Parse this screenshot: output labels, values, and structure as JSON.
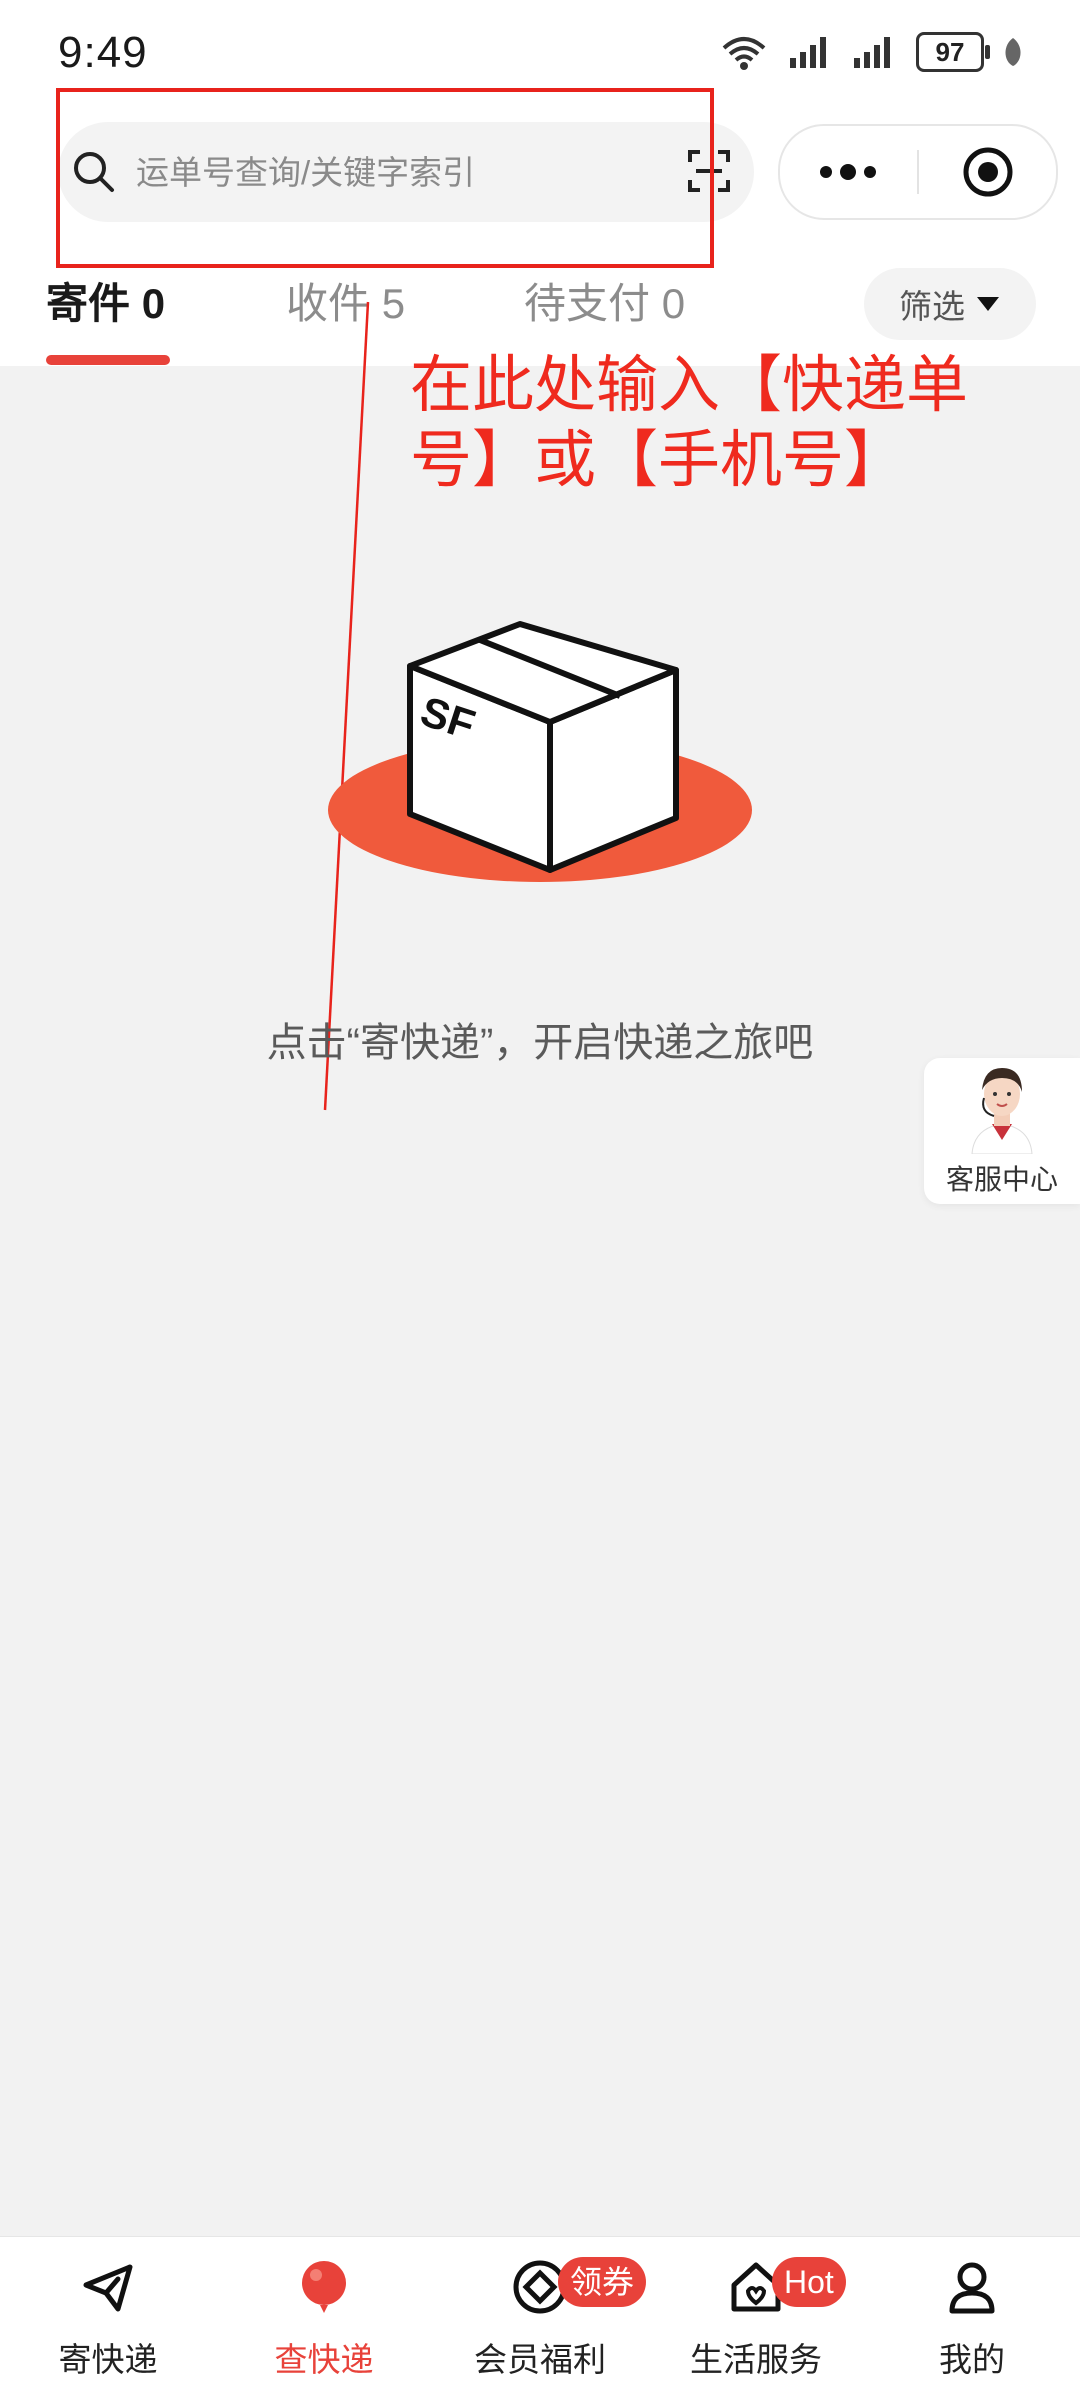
{
  "status_bar": {
    "time": "9:49",
    "battery": "97"
  },
  "search": {
    "placeholder": "运单号查询/关键字索引"
  },
  "tabs": [
    {
      "label": "寄件",
      "count": "0"
    },
    {
      "label": "收件",
      "count": "5"
    },
    {
      "label": "待支付",
      "count": "0"
    }
  ],
  "filter": {
    "label": "筛选"
  },
  "annotation": {
    "text": "在此处输入【快递单号】或【手机号】"
  },
  "empty_state": {
    "logo_text": "SF",
    "message": "点击“寄快递”，开启快递之旅吧"
  },
  "customer_service": {
    "label": "客服中心"
  },
  "bottom_nav": [
    {
      "label": "寄快递",
      "icon": "paper-plane-icon"
    },
    {
      "label": "查快递",
      "icon": "balloon-icon"
    },
    {
      "label": "会员福利",
      "icon": "coin-icon",
      "badge": "领券"
    },
    {
      "label": "生活服务",
      "icon": "home-icon",
      "badge": "Hot"
    },
    {
      "label": "我的",
      "icon": "user-icon"
    }
  ],
  "colors": {
    "accent": "#e8423a",
    "annotation": "#ef2a1e",
    "background": "#f2f2f2"
  }
}
